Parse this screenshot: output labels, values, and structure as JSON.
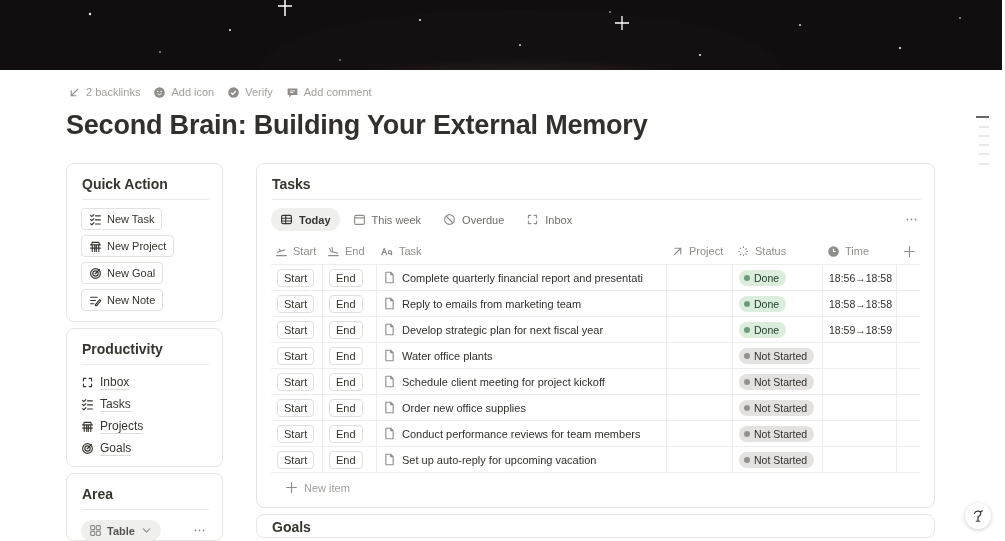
{
  "page_actions": [
    "2 backlinks",
    "Add icon",
    "Verify",
    "Add comment"
  ],
  "title": "Second Brain: Building Your External Memory",
  "quick_action": {
    "title": "Quick Action",
    "buttons": [
      "New Task",
      "New Project",
      "New Goal",
      "New Note"
    ]
  },
  "productivity": {
    "title": "Productivity",
    "links": [
      "Inbox",
      "Tasks",
      "Projects",
      "Goals"
    ]
  },
  "area": {
    "title": "Area",
    "view": "Table"
  },
  "tasks": {
    "title": "Tasks",
    "tabs": [
      {
        "label": "Today",
        "selected": true
      },
      {
        "label": "This week",
        "selected": false
      },
      {
        "label": "Overdue",
        "selected": false
      },
      {
        "label": "Inbox",
        "selected": false
      }
    ],
    "columns": [
      "Start",
      "End",
      "Task",
      "Project",
      "Status",
      "Time"
    ],
    "rows": [
      {
        "start": "Start",
        "end": "End",
        "task": "Complete quarterly financial report and presentati",
        "status": {
          "label": "Done",
          "kind": "done"
        },
        "time": "18:56→18:58"
      },
      {
        "start": "Start",
        "end": "End",
        "task": "Reply to emails from marketing team",
        "status": {
          "label": "Done",
          "kind": "done"
        },
        "time": "18:58→18:58"
      },
      {
        "start": "Start",
        "end": "End",
        "task": "Develop strategic plan for next fiscal year",
        "status": {
          "label": "Done",
          "kind": "done"
        },
        "time": "18:59→18:59"
      },
      {
        "start": "Start",
        "end": "End",
        "task": "Water office plants",
        "status": {
          "label": "Not Started",
          "kind": "not-started"
        }
      },
      {
        "start": "Start",
        "end": "End",
        "task": "Schedule client meeting for project kickoff",
        "status": {
          "label": "Not Started",
          "kind": "not-started"
        }
      },
      {
        "start": "Start",
        "end": "End",
        "task": "Order new office supplies",
        "status": {
          "label": "Not Started",
          "kind": "not-started"
        }
      },
      {
        "start": "Start",
        "end": "End",
        "task": "Conduct performance reviews for team members",
        "status": {
          "label": "Not Started",
          "kind": "not-started"
        }
      },
      {
        "start": "Start",
        "end": "End",
        "task": "Set up auto-reply for upcoming vacation",
        "status": {
          "label": "Not Started",
          "kind": "not-started"
        }
      }
    ],
    "new_item": "New item"
  },
  "goals": {
    "title": "Goals"
  }
}
